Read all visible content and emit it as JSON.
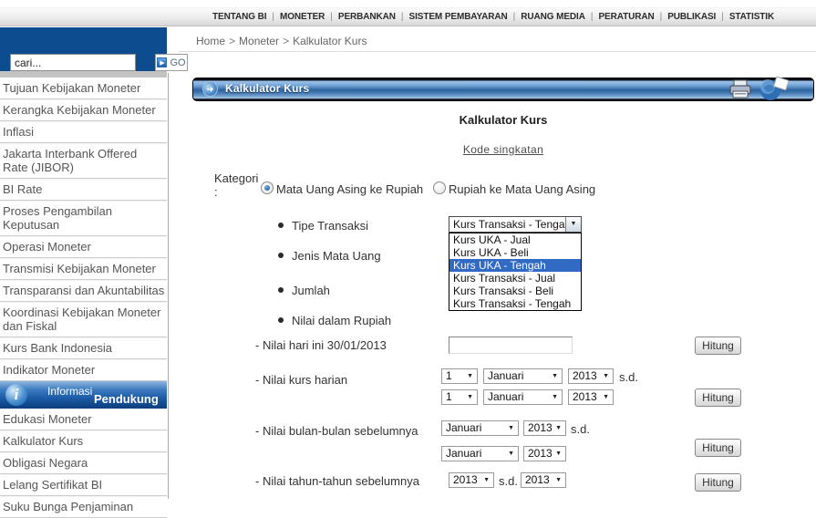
{
  "topnav": {
    "separator": "|",
    "items": [
      "TENTANG BI",
      "MONETER",
      "PERBANKAN",
      "SISTEM PEMBAYARAN",
      "RUANG MEDIA",
      "PERATURAN",
      "PUBLIKASI",
      "STATISTIK"
    ]
  },
  "breadcrumb": {
    "separator": ">",
    "parts": [
      "Home",
      "Moneter",
      "Kalkulator Kurs"
    ]
  },
  "sidebar": {
    "search": {
      "value": "cari...",
      "go_label": "GO",
      "go_arrow": "▶"
    },
    "menu_top": [
      "Tujuan Kebijakan Moneter",
      "Kerangka Kebijakan Moneter",
      "Inflasi",
      "Jakarta Interbank Offered Rate (JIBOR)",
      "BI Rate",
      "Proses Pengambilan Keputusan",
      "Operasi Moneter",
      "Transmisi Kebijakan Moneter",
      "Transparansi dan Akuntabilitas",
      "Koordinasi Kebijakan Moneter dan Fiskal",
      "Kurs Bank Indonesia",
      "Indikator Moneter"
    ],
    "section_header": {
      "word1": "Informasi",
      "word2": "Pendukung",
      "icon_glyph": "i"
    },
    "menu_bottom": [
      "Edukasi Moneter",
      "Kalkulator Kurs",
      "Obligasi Negara",
      "Lelang Sertifikat BI",
      "Suku Bunga Penjaminan"
    ]
  },
  "panel": {
    "title": "Kalkulator Kurs",
    "left_icon_glyph": "➜"
  },
  "calculator": {
    "title": "Kalkulator Kurs",
    "shortcode_link": "Kode singkatan",
    "kategori_label": "Kategori :",
    "radios": [
      {
        "label": "Mata Uang Asing ke Rupiah",
        "checked": true
      },
      {
        "label": "Rupiah ke Mata Uang Asing",
        "checked": false
      }
    ],
    "field_labels": [
      "Tipe Transaksi",
      "Jenis Mata Uang",
      "Jumlah",
      "Nilai dalam Rupiah"
    ],
    "tipe_select": {
      "value": "Kurs Transaksi - Tengah",
      "highlighted_index": 2,
      "options": [
        "Kurs UKA - Jual",
        "Kurs UKA - Beli",
        "Kurs UKA - Tengah",
        "Kurs Transaksi - Jual",
        "Kurs Transaksi - Beli",
        "Kurs Transaksi - Tengah"
      ]
    },
    "rows": {
      "hari_ini": {
        "label": "- Nilai hari ini 30/01/2013",
        "input_value": "",
        "button": "Hitung"
      },
      "kurs_harian": {
        "label": "- Nilai kurs harian",
        "sd": "s.d.",
        "from": {
          "day": "1",
          "month": "Januari",
          "year": "2013"
        },
        "to": {
          "day": "1",
          "month": "Januari",
          "year": "2013"
        },
        "button": "Hitung"
      },
      "bulan": {
        "label": "- Nilai bulan-bulan sebelumnya",
        "sd": "s.d.",
        "from": {
          "month": "Januari",
          "year": "2013"
        },
        "to": {
          "month": "Januari",
          "year": "2013"
        },
        "button": "Hitung"
      },
      "tahun": {
        "label": "- Nilai tahun-tahun sebelumnya",
        "sd": "s.d.",
        "from": {
          "year": "2013"
        },
        "to": {
          "year": "2013"
        },
        "button": "Hitung"
      }
    }
  },
  "colors": {
    "sidebar_blue": "#0d4d8f",
    "selection_blue": "#316ac5",
    "panel_bar_blue": "#2e659f",
    "nav_text": "#2b2b2b",
    "menu_text": "#555555"
  }
}
